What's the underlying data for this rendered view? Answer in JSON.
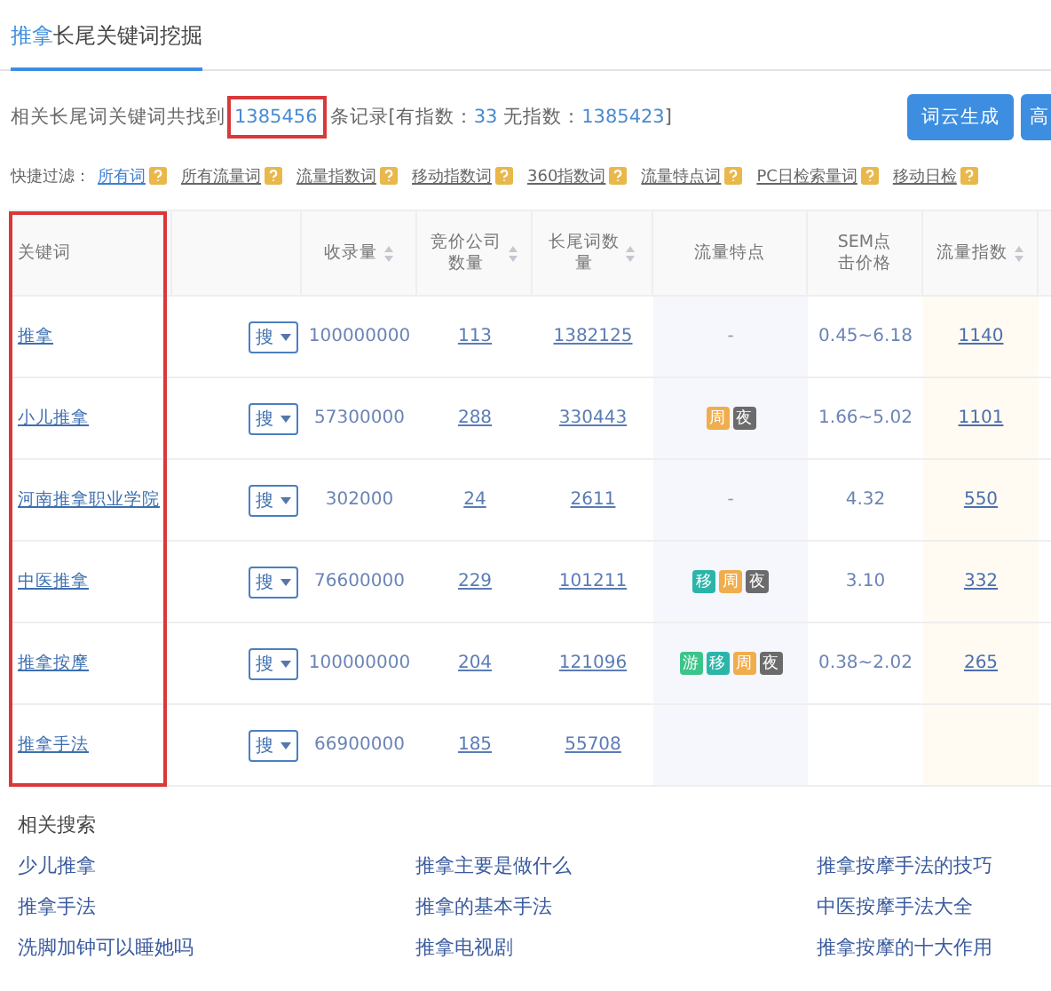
{
  "tab": {
    "keyword": "推拿",
    "rest": "长尾关键词挖掘",
    "selected": true
  },
  "summary": {
    "prefix": "相关长尾词关键词共找到",
    "total": "1385456",
    "mid": "条记录[有指数：",
    "indexed": "33",
    "mid2": "无指数：",
    "unindexed": "1385423",
    "suffix": "]"
  },
  "buttons": [
    "词云生成",
    "高"
  ],
  "filters": {
    "label": "快捷过滤：",
    "items": [
      {
        "label": "所有词",
        "selected": true
      },
      {
        "label": "所有流量词",
        "selected": false
      },
      {
        "label": "流量指数词",
        "selected": false
      },
      {
        "label": "移动指数词",
        "selected": false
      },
      {
        "label": "360指数词",
        "selected": false
      },
      {
        "label": "流量特点词",
        "selected": false
      },
      {
        "label": "PC日检索量词",
        "selected": false
      },
      {
        "label": "移动日检",
        "selected": false
      }
    ]
  },
  "table": {
    "columns": [
      {
        "label": "关键词",
        "sortable": false
      },
      {
        "label": "收录量",
        "sortable": true
      },
      {
        "label": "竞价公司数量",
        "sortable": true
      },
      {
        "label": "长尾词数量",
        "sortable": true
      },
      {
        "label": "流量特点",
        "sortable": false
      },
      {
        "label": "SEM点击价格",
        "sortable": false
      },
      {
        "label": "流量指数",
        "sortable": true
      }
    ],
    "rows": [
      {
        "keyword": "推拿",
        "search": "搜",
        "indexed": "100000000",
        "bidders": "113",
        "longtail": "1382125",
        "trait_none": "-",
        "sem": "0.45~6.18",
        "traffic_index": "1140"
      },
      {
        "keyword": "小儿推拿",
        "search": "搜",
        "indexed": "57300000",
        "bidders": "288",
        "longtail": "330443",
        "traits": [
          {
            "text": "周",
            "color": "#f0ad4e"
          },
          {
            "text": "夜",
            "color": "#6b6b6b"
          }
        ],
        "sem": "1.66~5.02",
        "traffic_index": "1101"
      },
      {
        "keyword": "河南推拿职业学院",
        "search": "搜",
        "indexed": "302000",
        "bidders": "24",
        "longtail": "2611",
        "trait_none": "-",
        "sem": "4.32",
        "traffic_index": "550"
      },
      {
        "keyword": "中医推拿",
        "search": "搜",
        "indexed": "76600000",
        "bidders": "229",
        "longtail": "101211",
        "traits": [
          {
            "text": "移",
            "color": "#2bb5a8"
          },
          {
            "text": "周",
            "color": "#f0ad4e"
          },
          {
            "text": "夜",
            "color": "#6b6b6b"
          }
        ],
        "sem": "3.10",
        "traffic_index": "332"
      },
      {
        "keyword": "推拿按摩",
        "search": "搜",
        "indexed": "100000000",
        "bidders": "204",
        "longtail": "121096",
        "traits": [
          {
            "text": "游",
            "color": "#3cc48a"
          },
          {
            "text": "移",
            "color": "#2bb5a8"
          },
          {
            "text": "周",
            "color": "#f0ad4e"
          },
          {
            "text": "夜",
            "color": "#6b6b6b"
          }
        ],
        "sem": "0.38~2.02",
        "traffic_index": "265"
      },
      {
        "keyword": "推拿手法",
        "search": "搜",
        "indexed": "66900000",
        "bidders": "185",
        "longtail": "55708"
      }
    ]
  },
  "related": {
    "title": "相关搜索",
    "links": [
      "少儿推拿",
      "推拿主要是做什么",
      "推拿按摩手法的技巧",
      "推拿手法",
      "推拿的基本手法",
      "中医按摩手法大全",
      "洗脚加钟可以睡她吗",
      "推拿电视剧",
      "推拿按摩的十大作用"
    ]
  }
}
